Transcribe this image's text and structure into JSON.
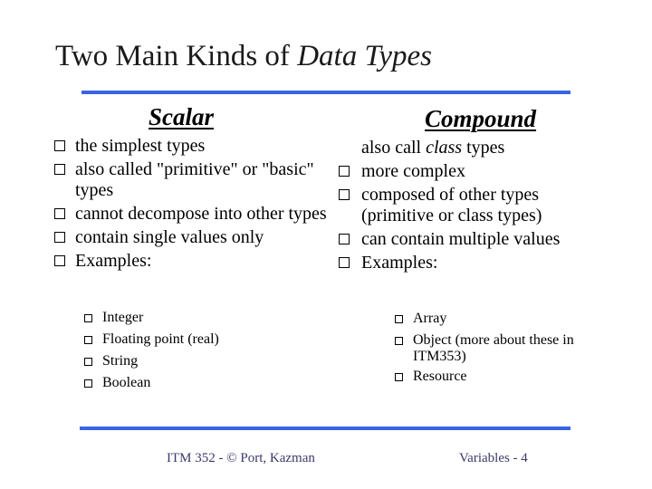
{
  "slide": {
    "title_plain": "Two Main Kinds of ",
    "title_italic": "Data Types",
    "accent_color": "#3b63e0"
  },
  "scalar": {
    "heading": "Scalar",
    "bullets": [
      "the simplest types",
      "also called \"primitive\" or \"basic\" types",
      "cannot decompose into other types",
      "contain single values only",
      "Examples:"
    ],
    "examples": [
      "Integer",
      "Floating point (real)",
      "String",
      "Boolean"
    ]
  },
  "compound": {
    "heading": "Compound",
    "intro_prefix": "also call ",
    "intro_italic": "class",
    "intro_suffix": " types",
    "bullets": [
      "more complex",
      "composed of other types (primitive or class types)",
      "can contain multiple values",
      "Examples:"
    ],
    "examples": [
      "Array",
      "Object (more about these in ITM353)",
      "Resource"
    ]
  },
  "footer": {
    "left": "ITM 352 - © Port, Kazman",
    "right": "Variables - 4"
  }
}
